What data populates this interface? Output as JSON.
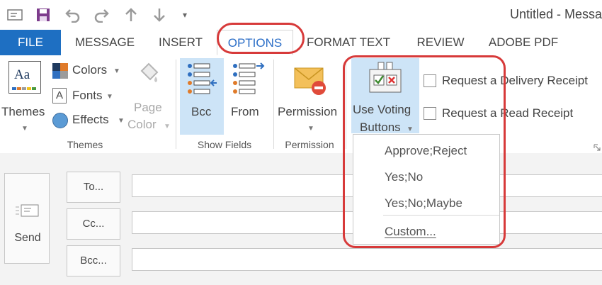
{
  "window": {
    "title": "Untitled - Messa"
  },
  "quick_access": {
    "icons": [
      "mail-icon",
      "save-icon",
      "undo-icon",
      "redo-icon",
      "up-arrow-icon",
      "down-arrow-icon",
      "customize-qat-icon"
    ],
    "customize_glyph": "▾"
  },
  "tabs": [
    {
      "label": "FILE"
    },
    {
      "label": "MESSAGE"
    },
    {
      "label": "INSERT"
    },
    {
      "label": "OPTIONS"
    },
    {
      "label": "FORMAT TEXT"
    },
    {
      "label": "REVIEW"
    },
    {
      "label": "ADOBE PDF"
    }
  ],
  "ribbon": {
    "themes_group": {
      "label": "Themes",
      "themes_button": "Themes",
      "colors_button": "Colors",
      "fonts_button": "Fonts",
      "effects_button": "Effects",
      "page_color_line1": "Page",
      "page_color_line2": "Color",
      "theme_icon_text": "Aa"
    },
    "show_fields_group": {
      "label": "Show Fields",
      "bcc_button": "Bcc",
      "from_button": "From"
    },
    "permission_group": {
      "label": "Permission",
      "permission_button": "Permission"
    },
    "tracking_group": {
      "voting_line1": "Use Voting",
      "voting_line2": "Buttons",
      "delivery_receipt": "Request a Delivery Receipt",
      "read_receipt": "Request a Read Receipt",
      "delivery_checked": false,
      "read_checked": false
    },
    "dialog_launcher_icon": "dialog-launcher-icon"
  },
  "compose": {
    "send_label": "Send",
    "to_label": "To...",
    "cc_label": "Cc...",
    "bcc_label": "Bcc..."
  },
  "voting_menu": {
    "items": [
      "Approve;Reject",
      "Yes;No",
      "Yes;No;Maybe",
      "Custom..."
    ]
  },
  "colors": {
    "file_tab": "#1e6fc2",
    "accent": "#2b6ec7",
    "highlight": "#cde4f7",
    "annotation": "#d73a3a"
  }
}
